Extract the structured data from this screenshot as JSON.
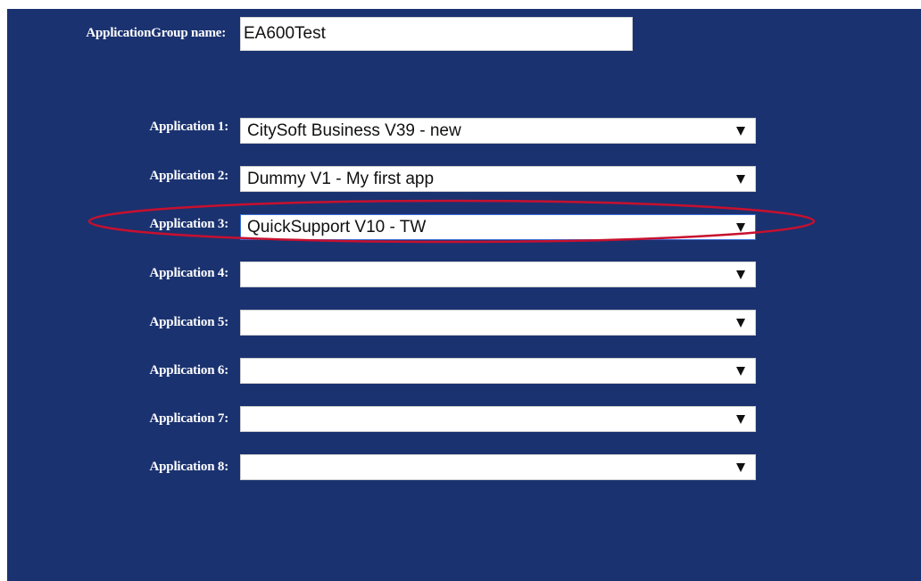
{
  "form": {
    "group_name_label": "ApplicationGroup name:",
    "group_name_value": "EA600Test"
  },
  "applications": [
    {
      "label": "Application 1:",
      "value": "CitySoft Business V39 - new"
    },
    {
      "label": "Application 2:",
      "value": "Dummy V1 - My first app"
    },
    {
      "label": "Application 3:",
      "value": "QuickSupport V10 - TW"
    },
    {
      "label": "Application 4:",
      "value": ""
    },
    {
      "label": "Application 5:",
      "value": ""
    },
    {
      "label": "Application 6:",
      "value": ""
    },
    {
      "label": "Application 7:",
      "value": ""
    },
    {
      "label": "Application 8:",
      "value": ""
    }
  ],
  "colors": {
    "background": "#1a3270",
    "annotation": "#c8102e"
  }
}
